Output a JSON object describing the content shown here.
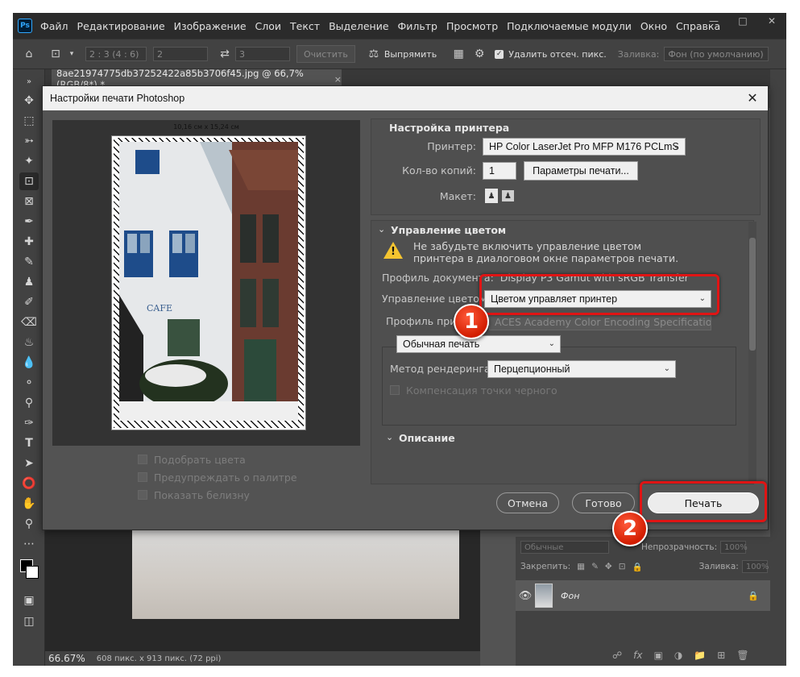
{
  "app": {
    "logo": "Ps",
    "menu": [
      "Файл",
      "Редактирование",
      "Изображение",
      "Слои",
      "Текст",
      "Выделение",
      "Фильтр",
      "Просмотр",
      "Подключаемые модули",
      "Окно",
      "Справка"
    ]
  },
  "options_bar": {
    "ratio_value": "2 : 3 (4 : 6)",
    "width_value": "2",
    "height_value": "3",
    "clear_label": "Очистить",
    "straighten_label": "Выпрямить",
    "delete_cropped_label": "Удалить отсеч. пикс.",
    "fill_label": "Заливка:",
    "fill_value": "Фон (по умолчанию)"
  },
  "document": {
    "tab_title": "8ae21974775db37252422a85b3706f45.jpg @ 66,7% (RGB/8*) *",
    "close_glyph": "×"
  },
  "status": {
    "zoom": "66.67%",
    "doc_info": "608 пикс. x 913 пикс. (72 ppi)"
  },
  "layers": {
    "blend_mode": "Обычные",
    "opacity_label": "Непрозрачность:",
    "opacity_value": "100%",
    "lock_label": "Закрепить:",
    "fill_label": "Заливка:",
    "fill_value": "100%",
    "layer_name": "Фон",
    "footer_fx": "fx"
  },
  "dialog": {
    "title": "Настройки печати Photoshop",
    "preview_size": "10,16 см x 15,24 см",
    "checks": [
      "Подобрать цвета",
      "Предупреждать о палитре",
      "Показать белизну"
    ],
    "printer_setup": {
      "title": "Настройка принтера",
      "printer_label": "Принтер:",
      "printer_value": "HP Color LaserJet Pro MFP M176 PCLmS",
      "copies_label": "Кол-во копий:",
      "copies_value": "1",
      "print_settings_button": "Параметры печати...",
      "layout_label": "Макет:"
    },
    "color_management": {
      "title": "Управление цветом",
      "warning_line1": "Не забудьте включить управление цветом",
      "warning_line2": "принтера в диалоговом окне параметров печати.",
      "doc_profile_label": "Профиль документа:",
      "doc_profile_value": "Display P3 Gamut with sRGB Transfer",
      "color_handling_label": "Управление цветом:",
      "color_handling_value": "Цветом управляет принтер",
      "printer_profile_label": "Профиль принтера:",
      "printer_profile_value": "ACES Academy Color Encoding Specification...",
      "normal_print_value": "Обычная печать",
      "rendering_label": "Метод рендеринга:",
      "rendering_value": "Перцепционный",
      "bpc_label": "Компенсация точки черного"
    },
    "description": {
      "title": "Описание"
    },
    "buttons": {
      "cancel": "Отмена",
      "done": "Готово",
      "print": "Печать"
    }
  },
  "callouts": [
    "1",
    "2"
  ],
  "colors": {
    "callout_red": "#e01414",
    "warning_yellow": "#f4c430",
    "ps_blue": "#31a8ff"
  }
}
